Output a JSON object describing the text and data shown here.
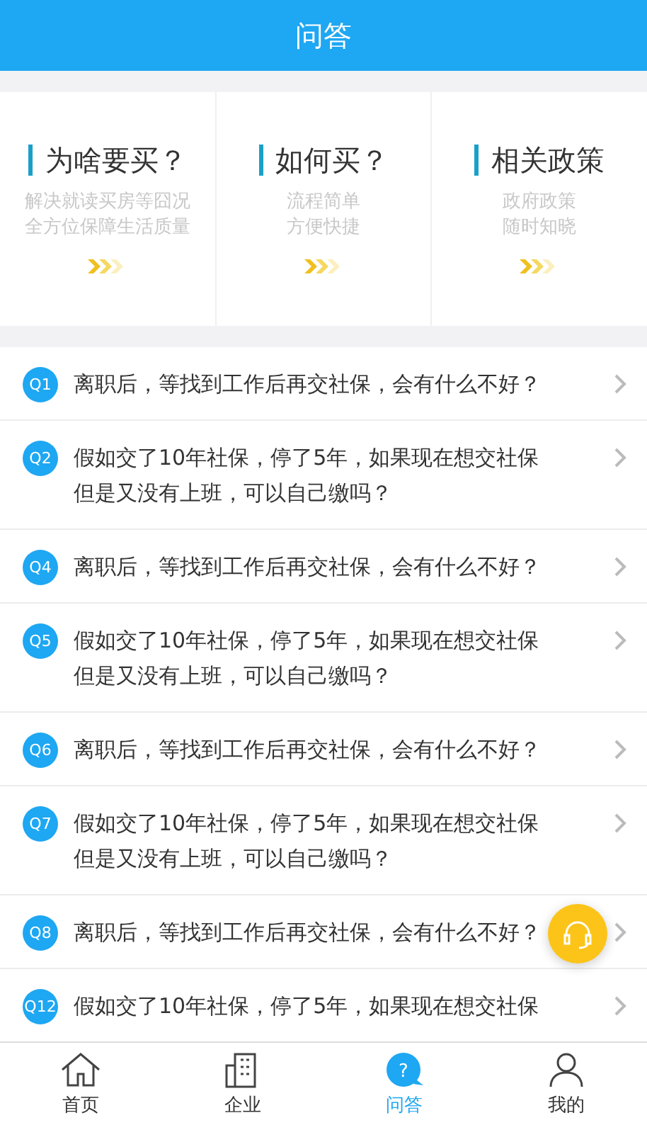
{
  "header": {
    "title": "问答"
  },
  "cards": [
    {
      "title": "为啥要买？",
      "lines": [
        "解决就读买房等囧况",
        "全方位保障生活质量"
      ]
    },
    {
      "title": "如何买？",
      "lines": [
        "流程简单",
        "方便快捷"
      ]
    },
    {
      "title": "相关政策",
      "lines": [
        "政府政策",
        "随时知晓"
      ]
    }
  ],
  "questions": [
    {
      "badge": "Q1",
      "lines": [
        "离职后，等找到工作后再交社保，会有什么不好？"
      ]
    },
    {
      "badge": "Q2",
      "lines": [
        "假如交了10年社保，停了5年，如果现在想交社保",
        "但是又没有上班，可以自己缴吗？"
      ]
    },
    {
      "badge": "Q4",
      "lines": [
        "离职后，等找到工作后再交社保，会有什么不好？"
      ]
    },
    {
      "badge": "Q5",
      "lines": [
        "假如交了10年社保，停了5年，如果现在想交社保",
        "但是又没有上班，可以自己缴吗？"
      ]
    },
    {
      "badge": "Q6",
      "lines": [
        "离职后，等找到工作后再交社保，会有什么不好？"
      ]
    },
    {
      "badge": "Q7",
      "lines": [
        "假如交了10年社保，停了5年，如果现在想交社保",
        "但是又没有上班，可以自己缴吗？"
      ]
    },
    {
      "badge": "Q8",
      "lines": [
        "离职后，等找到工作后再交社保，会有什么不好？"
      ]
    },
    {
      "badge": "Q12",
      "lines": [
        "假如交了10年社保，停了5年，如果现在想交社保"
      ]
    }
  ],
  "tabs": [
    {
      "kind": "home",
      "label": "首页",
      "selected": false
    },
    {
      "kind": "company",
      "label": "企业",
      "selected": false
    },
    {
      "kind": "qa",
      "label": "问答",
      "glyph": "?",
      "selected": true
    },
    {
      "kind": "me",
      "label": "我的",
      "selected": false
    }
  ]
}
